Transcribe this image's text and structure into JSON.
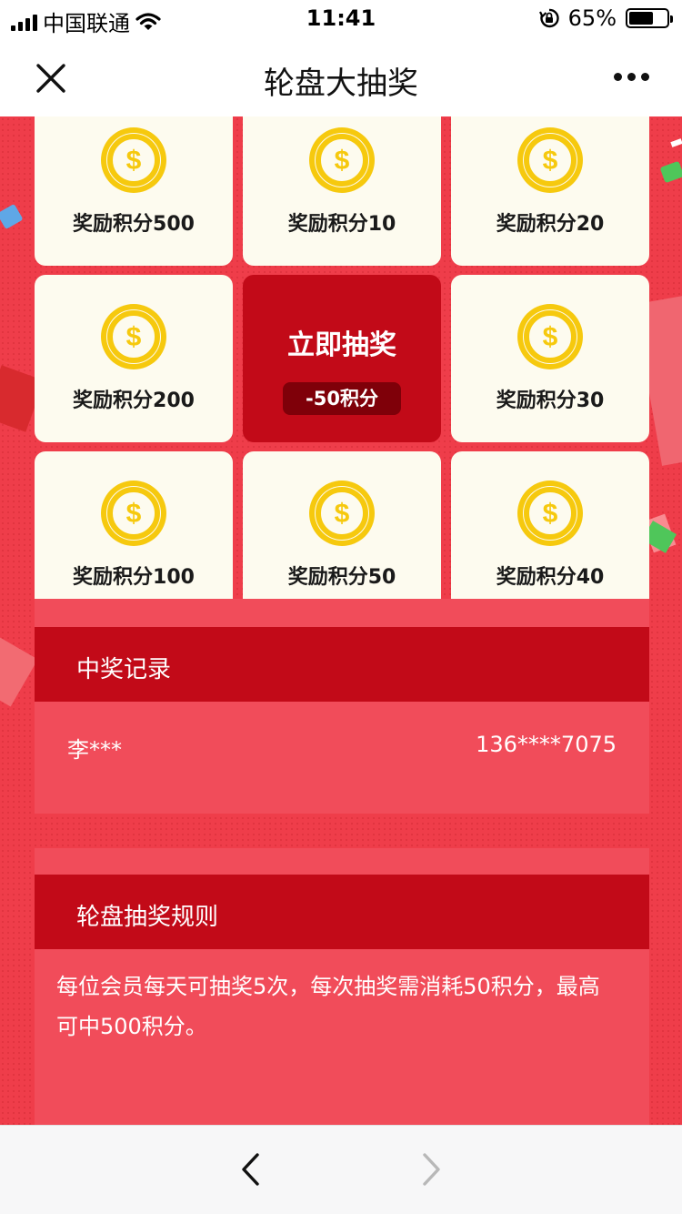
{
  "status_bar": {
    "carrier": "中国联通",
    "time": "11:41",
    "battery_text": "65%",
    "battery_level": 0.65
  },
  "nav": {
    "title": "轮盘大抽奖",
    "close_icon": "close-icon",
    "more_icon": "more-icon"
  },
  "lottery": {
    "cells": [
      {
        "label": "奖励积分500",
        "icon": "coin-icon"
      },
      {
        "label": "奖励积分10",
        "icon": "coin-icon"
      },
      {
        "label": "奖励积分20",
        "icon": "coin-icon"
      },
      {
        "label": "奖励积分200",
        "icon": "coin-icon"
      },
      {
        "label": "立即抽奖",
        "cost": "-50积分"
      },
      {
        "label": "奖励积分30",
        "icon": "coin-icon"
      },
      {
        "label": "奖励积分100",
        "icon": "coin-icon"
      },
      {
        "label": "奖励积分50",
        "icon": "coin-icon"
      },
      {
        "label": "奖励积分40",
        "icon": "coin-icon"
      }
    ]
  },
  "records": {
    "title": "中奖记录",
    "items": [
      {
        "name": "李***",
        "phone": "136****7075"
      }
    ]
  },
  "rules": {
    "title": "轮盘抽奖规则",
    "text": "每位会员每天可抽奖5次，每次抽奖需消耗50积分，最高可中500积分。"
  },
  "toolbar": {
    "back_icon": "chevron-left-icon",
    "forward_icon": "chevron-right-icon"
  },
  "colors": {
    "background": "#ef3d4a",
    "accent": "#c20a18",
    "card": "#fdfbef",
    "coin": "#f6c90e"
  }
}
